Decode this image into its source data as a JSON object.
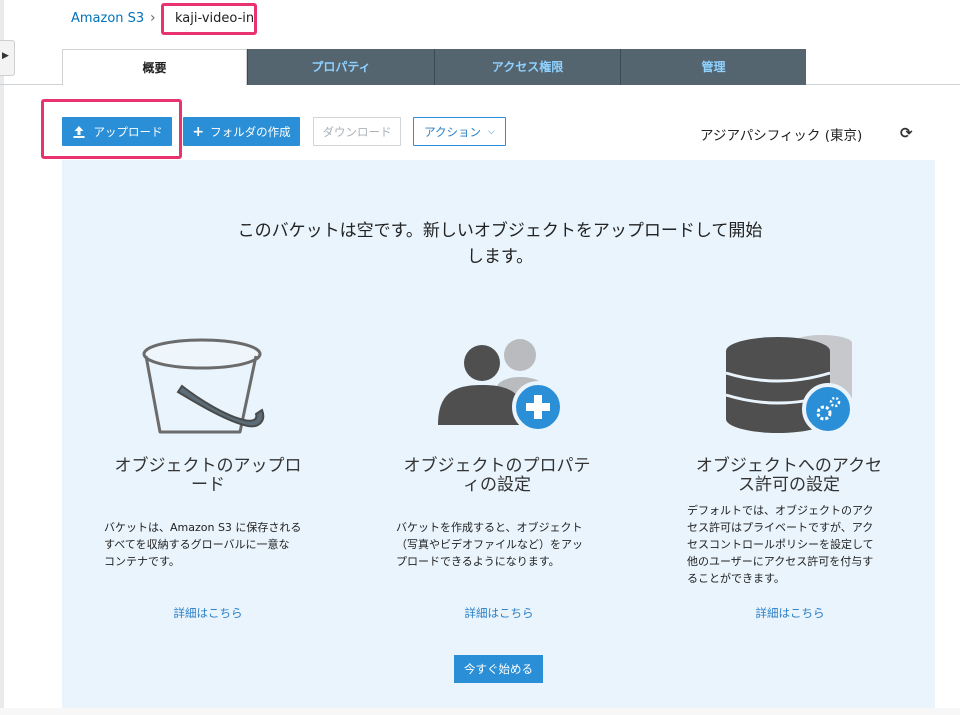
{
  "breadcrumb": {
    "root": "Amazon S3",
    "separator": "›",
    "current": "kaji-video-in"
  },
  "tabs": [
    {
      "label": "概要",
      "active": true
    },
    {
      "label": "プロパティ",
      "active": false
    },
    {
      "label": "アクセス権限",
      "active": false
    },
    {
      "label": "管理",
      "active": false
    }
  ],
  "toolbar": {
    "upload_label": "アップロード",
    "create_folder_label": "フォルダの作成",
    "download_label": "ダウンロード",
    "actions_label": "アクション",
    "region": "アジアパシフィック (東京)"
  },
  "empty_state": {
    "headline_line1": "このバケットは空です。新しいオブジェクトをアップロードして開始",
    "headline_line2": "します。",
    "columns": [
      {
        "icon": "bucket-icon",
        "title_line1": "オブジェクトのアップロ",
        "title_line2": "ード",
        "body": [
          "バケットは、Amazon S3 に保存される",
          "すべてを収納するグローバルに一意な",
          "コンテナです。"
        ],
        "link": "詳細はこちら"
      },
      {
        "icon": "users-add-icon",
        "title_line1": "オブジェクトのプロパテ",
        "title_line2": "ィの設定",
        "body": [
          "バケットを作成すると、オブジェクト",
          "（写真やビデオファイルなど）をアッ",
          "プロードできるようになります。"
        ],
        "link": "詳細はこちら"
      },
      {
        "icon": "database-gear-icon",
        "title_line1": "オブジェクトへのアクセ",
        "title_line2": "ス許可の設定",
        "body": [
          "デフォルトでは、オブジェクトのアク",
          "セス許可はプライベートですが、アク",
          "セスコントロールポリシーを設定して",
          "他のユーザーにアクセス許可を付与す",
          "ることができます。"
        ],
        "link": "詳細はこちら"
      }
    ],
    "start_button": "今すぐ始める"
  },
  "colors": {
    "primary": "#2a8fd6",
    "tab_inactive": "#546570",
    "tab_text": "#8fd1ff",
    "panel": "#e9f4fc",
    "highlight": "#e8336e"
  }
}
